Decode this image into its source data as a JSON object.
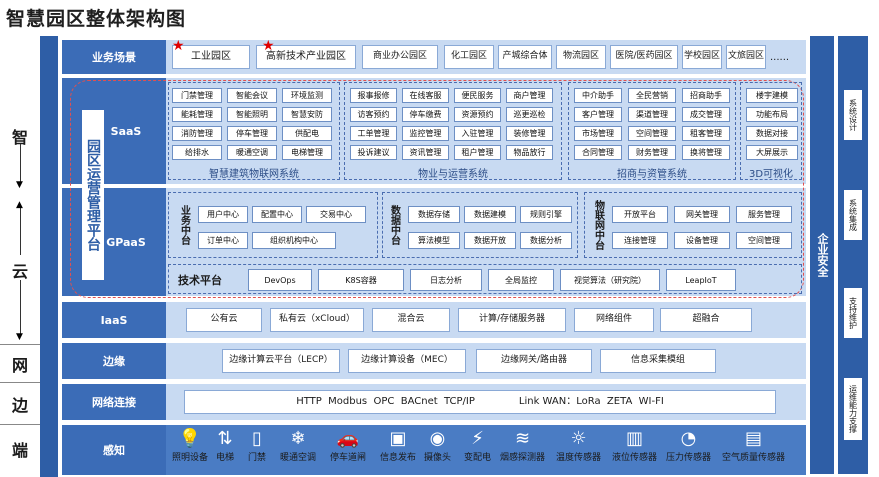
{
  "title": "智慧园区整体架构图",
  "left": {
    "chars": [
      "智",
      "云",
      "网",
      "边",
      "端"
    ]
  },
  "rows": {
    "scene": "业务场景",
    "saas": "SaaS",
    "gpaas": "GPaaS",
    "iaas": "IaaS",
    "edge": "边缘",
    "net": "网络连接",
    "sense": "感知"
  },
  "scenes": [
    "工业园区",
    "高新技术产业园区",
    "商业办公园区",
    "化工园区",
    "产城综合体",
    "物流园区",
    "医院/医药园区",
    "学校园区",
    "文旅园区",
    "......"
  ],
  "ops_platform": "园区运营管理平台",
  "saas": {
    "g1": {
      "items": [
        "门禁管理",
        "智能会议",
        "环境监测",
        "能耗管理",
        "智能照明",
        "智慧安防",
        "消防管理",
        "停车管理",
        "供配电",
        "给排水",
        "暖通空调",
        "电梯管理"
      ],
      "title": "智慧建筑物联网系统"
    },
    "g2": {
      "items": [
        "报事报修",
        "在线客服",
        "便民服务",
        "商户管理",
        "访客预约",
        "停车缴费",
        "资源预约",
        "巡更巡检",
        "工单管理",
        "监控管理",
        "入驻管理",
        "装修管理",
        "投诉建议",
        "资讯管理",
        "租户管理",
        "物品放行"
      ],
      "title": "物业与运营系统"
    },
    "g3": {
      "items": [
        "中介助手",
        "全民营销",
        "招商助手",
        "客户管理",
        "渠道管理",
        "成交管理",
        "市场管理",
        "空间管理",
        "租客管理",
        "合同管理",
        "财务管理",
        "换将管理"
      ],
      "title": "招商与资管系统"
    },
    "g4": {
      "items": [
        "楼宇建模",
        "功能布局",
        "数据对接",
        "大屏展示"
      ],
      "title": "3D可视化"
    }
  },
  "gpaas": {
    "biz": {
      "label": "业务中台",
      "items": [
        "用户中心",
        "配置中心",
        "交易中心",
        "订单中心",
        "组织机构中心"
      ]
    },
    "data": {
      "label": "数据中台",
      "items": [
        "数据存储",
        "数据建模",
        "规则引擎",
        "算法模型",
        "数据开放",
        "数据分析"
      ]
    },
    "iot": {
      "label": "物联网中台",
      "items": [
        "开放平台",
        "网关管理",
        "服务管理",
        "连接管理",
        "设备管理",
        "空间管理"
      ]
    },
    "tech": {
      "label": "技术平台",
      "items": [
        "DevOps",
        "K8S容器",
        "日志分析",
        "全局监控",
        "视觉算法（研究院）",
        "LeapIoT"
      ]
    }
  },
  "iaas": [
    "公有云",
    "私有云（xCloud）",
    "混合云",
    "计算/存储服务器",
    "网络组件",
    "超融合"
  ],
  "edge": [
    "边缘计算云平台（LECP）",
    "边缘计算设备（MEC）",
    "边缘网关/路由器",
    "信息采集模组"
  ],
  "net": {
    "protocols": "HTTP  Modbus  OPC  BACnet  TCP/IP",
    "wan": "Link WAN：LoRa  ZETA  WI-FI"
  },
  "sense": [
    {
      "label": "照明设备",
      "icon": "bulb-icon",
      "glyph": "💡"
    },
    {
      "label": "电梯",
      "icon": "elevator-icon",
      "glyph": "⇅"
    },
    {
      "label": "门禁",
      "icon": "door-icon",
      "glyph": "▯"
    },
    {
      "label": "暖通空调",
      "icon": "ac-icon",
      "glyph": "❄"
    },
    {
      "label": "停车道闸",
      "icon": "car-icon",
      "glyph": "🚗"
    },
    {
      "label": "信息发布",
      "icon": "screen-icon",
      "glyph": "▣"
    },
    {
      "label": "摄像头",
      "icon": "camera-icon",
      "glyph": "◉"
    },
    {
      "label": "变配电",
      "icon": "power-icon",
      "glyph": "⚡"
    },
    {
      "label": "烟感探测器",
      "icon": "smoke-icon",
      "glyph": "≋"
    },
    {
      "label": "温度传感器",
      "icon": "temp-icon",
      "glyph": "☼"
    },
    {
      "label": "液位传感器",
      "icon": "level-icon",
      "glyph": "▥"
    },
    {
      "label": "压力传感器",
      "icon": "pressure-icon",
      "glyph": "◔"
    },
    {
      "label": "空气质量传感器",
      "icon": "air-icon",
      "glyph": "▤"
    }
  ],
  "security": "企业安全",
  "right": [
    "系统设计",
    "系统集成",
    "支持维护",
    "运维能力支撑"
  ],
  "colors": {
    "primary": "#2e5ea6",
    "rowbg": "#c8daf2",
    "label": "#3b6cb7",
    "star": "#e00000",
    "dashed": "#e05050"
  }
}
